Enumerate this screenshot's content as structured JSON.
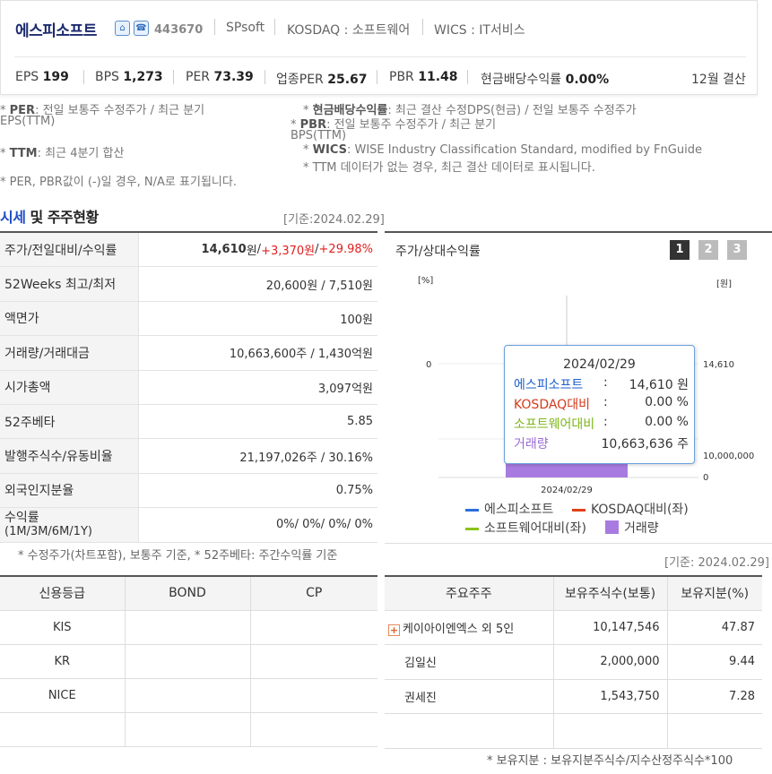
{
  "header": {
    "company_name": "에스피소프트",
    "code": "443670",
    "english_name": "SPsoft",
    "market": "KOSDAQ : 소프트웨어",
    "wics": "WICS : IT서비스",
    "icons": [
      "home-icon",
      "phone-icon"
    ],
    "stats": [
      {
        "label": "EPS",
        "value": "199"
      },
      {
        "label": "BPS",
        "value": "1,273"
      },
      {
        "label": "PER",
        "value": "73.39"
      },
      {
        "label": "업종PER",
        "value": "25.67"
      },
      {
        "label": "PBR",
        "value": "11.48"
      },
      {
        "label": "현금배당수익률",
        "value": "0.00%"
      }
    ],
    "fiscal": "12월 결산"
  },
  "notes": {
    "per_key": "PER",
    "per_text": ": 전일 보통주 수정주가 / 최근 분기",
    "per_text2": "EPS(TTM)",
    "div_key": "현금배당수익률",
    "div_text": ": 최근 결산 수정DPS(현금) / 전일 보통주 수정주가",
    "pbr_key": "PBR",
    "pbr_text": ": 전일 보통주 수정주가 / 최근 분기",
    "pbr_text2": "BPS(TTM)",
    "ttm_key": "TTM",
    "ttm_text": ": 최근 4분기 합산",
    "wics_key": "WICS",
    "wics_text": ": WISE Industry Classification Standard, modified by FnGuide",
    "ttm_note": "* TTM 데이터가 없는 경우, 최근 결산 데이터로 표시됩니다.",
    "na_note": "* PER, PBR값이 (-)일 경우, N/A로 표기됩니다."
  },
  "section": {
    "title_hl": "시세",
    "title_rest": " 및 주주현황",
    "base_date": "[기준:2024.02.29]"
  },
  "market_table": [
    {
      "label": "주가/전일대비/수익률"
    },
    {
      "label": "52Weeks 최고/최저",
      "value": "20,600원 / 7,510원"
    },
    {
      "label": "액면가",
      "value": "100원"
    },
    {
      "label": "거래량/거래대금",
      "value": "10,663,600주 / 1,430억원"
    },
    {
      "label": "시가총액",
      "value": "3,097억원"
    },
    {
      "label": "52주베타",
      "value": "5.85"
    },
    {
      "label": "발행주식수/유동비율",
      "value": "21,197,026주 / 30.16%"
    },
    {
      "label": "외국인지분율",
      "value": "0.75%"
    },
    {
      "label": "수익률",
      "label2": "(1M/3M/6M/1Y)",
      "value": "0%/ 0%/ 0%/ 0%"
    }
  ],
  "price": {
    "close": "14,610",
    "unit": "원",
    "change": "+3,370원",
    "rate": "+29.98%",
    "sep": " / "
  },
  "market_note": "* 수정주가(차트포함), 보통주 기준, * 52주베타: 주간수익률 기준",
  "chart_panel": {
    "title": "주가/상대수익률",
    "buttons": [
      "1",
      "2",
      "3"
    ],
    "left_unit": "[%]",
    "right_unit": "[원]",
    "tooltip": {
      "date": "2024/02/29",
      "rows": [
        {
          "label": "에스피소프트",
          "colon": ":",
          "value": "14,610 원",
          "color": "#1f5fcf"
        },
        {
          "label": "KOSDAQ대비",
          "colon": ":",
          "value": "0.00 %",
          "color": "#d43a1a"
        },
        {
          "label": "소프트웨어대비",
          "colon": ":",
          "value": "0.00 %",
          "color": "#7cb518"
        },
        {
          "label": "거래량",
          "colon": ":",
          "value": "10,663,636 주",
          "color": "#9b6bd6"
        }
      ]
    },
    "legend": [
      {
        "label": "에스피소프트",
        "color": "#2b6fdc"
      },
      {
        "label": "KOSDAQ대비(좌)",
        "color": "#e0401a"
      },
      {
        "label": "소프트웨어대비(좌)",
        "color": "#8cc21c"
      },
      {
        "label": "거래량",
        "color": "#a87be0"
      }
    ]
  },
  "chart_data": {
    "type": "bar",
    "x": [
      "2024/02/29"
    ],
    "xlabel": "",
    "ylabel": "[%]",
    "ylabel_right": "[원]",
    "left_ticks": [
      "0"
    ],
    "right_ticks": [
      "14,610",
      "10,000,000",
      "0"
    ],
    "series": [
      {
        "name": "에스피소프트",
        "values": [
          14610
        ]
      },
      {
        "name": "KOSDAQ대비(좌)",
        "values": [
          0.0
        ]
      },
      {
        "name": "소프트웨어대비(좌)",
        "values": [
          0.0
        ]
      },
      {
        "name": "거래량",
        "values": [
          10663636
        ]
      }
    ],
    "volume_max": 10000000,
    "grid": true,
    "legend": "bottom"
  },
  "chart_base_date": "[기준: 2024.02.29]",
  "credit": {
    "headers": [
      "신용등급",
      "BOND",
      "CP"
    ],
    "rows": [
      [
        "KIS",
        "",
        ""
      ],
      [
        "KR",
        "",
        ""
      ],
      [
        "NICE",
        "",
        ""
      ],
      [
        "",
        "",
        ""
      ]
    ]
  },
  "holders": {
    "headers": [
      "주요주주",
      "보유주식수(보통)",
      "보유지분(%)"
    ],
    "rows": [
      {
        "name": "케이아이엔엑스 외 5인",
        "shares": "10,147,546",
        "pct": "47.87",
        "expand": true
      },
      {
        "name": "김일신",
        "shares": "2,000,000",
        "pct": "9.44"
      },
      {
        "name": "권세진",
        "shares": "1,543,750",
        "pct": "7.28"
      },
      {
        "name": "",
        "shares": "",
        "pct": ""
      }
    ],
    "note": "* 보유지분 : 보유지분주식수/지수산정주식수*100"
  }
}
